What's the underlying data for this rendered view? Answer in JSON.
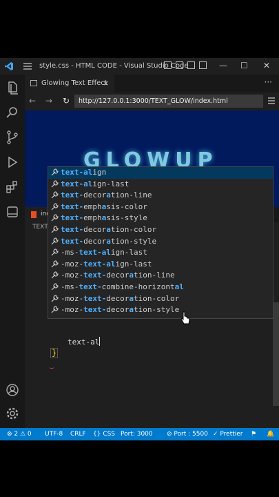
{
  "titlebar": {
    "title": "style.css - HTML CODE - Visual Studio Code"
  },
  "tab": {
    "label": "Glowing Text Effect",
    "close": "×"
  },
  "more": "···",
  "browser": {
    "back": "←",
    "forward": "→",
    "reload": "↻",
    "url": "http://127.0.0.1:3000/TEXT_GLOW/index.html"
  },
  "preview": {
    "heading": "GLOWUP"
  },
  "editor": {
    "tab_label": "ind",
    "breadcrumb": "TEXT",
    "typed_text": "text-al",
    "closing_brace": "}",
    "squiggle": "‿"
  },
  "suggestions": [
    {
      "pre": "",
      "m1": "text-al",
      "mid": "",
      "m2": "",
      "rest": "ign",
      "label": "text-align"
    },
    {
      "pre": "",
      "m1": "text-al",
      "mid": "",
      "m2": "",
      "rest": "ign-last",
      "label": "text-align-last"
    },
    {
      "pre": "",
      "m1": "text-",
      "mid": "decor",
      "m2": "a",
      "rest": "tion-line",
      "label": "text-decoration-line"
    },
    {
      "pre": "",
      "m1": "text-",
      "mid": "emph",
      "m2": "a",
      "rest": "sis-color",
      "label": "text-emphasis-color"
    },
    {
      "pre": "",
      "m1": "text-",
      "mid": "emph",
      "m2": "a",
      "rest": "sis-style",
      "label": "text-emphasis-style"
    },
    {
      "pre": "",
      "m1": "text-",
      "mid": "decor",
      "m2": "a",
      "rest": "tion-color",
      "label": "text-decoration-color"
    },
    {
      "pre": "",
      "m1": "text-",
      "mid": "decor",
      "m2": "a",
      "rest": "tion-style",
      "label": "text-decoration-style"
    },
    {
      "pre": "-ms-",
      "m1": "text-al",
      "mid": "",
      "m2": "",
      "rest": "ign-last",
      "label": "-ms-text-align-last"
    },
    {
      "pre": "-moz-",
      "m1": "text-al",
      "mid": "",
      "m2": "",
      "rest": "ign-last",
      "label": "-moz-text-align-last"
    },
    {
      "pre": "-moz-",
      "m1": "text-",
      "mid": "decor",
      "m2": "a",
      "rest": "tion-line",
      "label": "-moz-text-decoration-line"
    },
    {
      "pre": "-ms-",
      "m1": "text-",
      "mid": "combine-horizont",
      "m2": "al",
      "rest": "",
      "label": "-ms-text-combine-horizontal"
    },
    {
      "pre": "-moz-",
      "m1": "text-",
      "mid": "decor",
      "m2": "a",
      "rest": "tion-color",
      "label": "-moz-text-decoration-color"
    },
    {
      "pre": "-moz-",
      "m1": "text-",
      "mid": "decor",
      "m2": "a",
      "rest": "tion-style",
      "label": "-moz-text-decoration-style"
    }
  ],
  "status": {
    "errors": "⊗ 2 ⚠ 0",
    "encoding": "UTF-8",
    "eol": "CRLF",
    "language": "{} CSS",
    "port1": "Port: 3000",
    "port2": "⊘ Port : 5500",
    "prettier": "✓ Prettier"
  },
  "colors": {
    "statusbar": "#007acc",
    "preview_bg": "#001a5c",
    "glow": "#7fc9e0",
    "match": "#4fb0ff"
  }
}
